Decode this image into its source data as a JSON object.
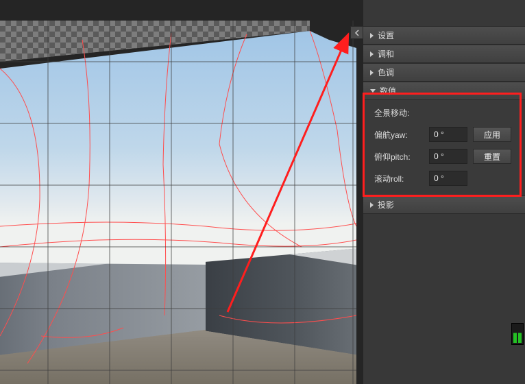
{
  "panels": {
    "settings": {
      "label": "设置",
      "expanded": false
    },
    "harmonize": {
      "label": "调和",
      "expanded": false
    },
    "tone": {
      "label": "色调",
      "expanded": false
    },
    "numeric": {
      "label": "数值",
      "expanded": true
    },
    "projection": {
      "label": "投影",
      "expanded": false
    }
  },
  "numeric": {
    "section_title": "全景移动:",
    "yaw": {
      "label": "偏航yaw:",
      "value": "0 °"
    },
    "pitch": {
      "label": "俯仰pitch:",
      "value": "0 °"
    },
    "roll": {
      "label": "滚动roll:",
      "value": "0 °"
    },
    "apply_label": "应用",
    "reset_label": "重置"
  },
  "collapse_handle": {
    "glyph": "chevron-left"
  }
}
